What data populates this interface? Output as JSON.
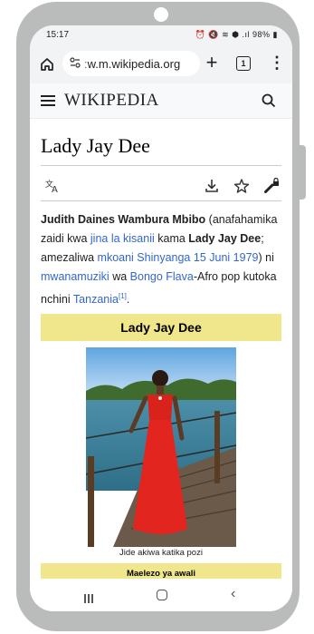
{
  "status_bar": {
    "time": "15:17",
    "indicators": "⏰ 🔇 ≋ ⬢ .ıl",
    "battery": "98%"
  },
  "browser": {
    "url": "ːw.m.wikipedia.org",
    "tab_count": "1"
  },
  "wiki": {
    "wordmark": "WIKIPEDIA",
    "title": "Lady Jay Dee",
    "intro": {
      "name": "Judith Daines Wambura Mbibo",
      "t1": " (anafahamika zaidi kwa ",
      "l1": "jina la kisanii",
      "t2": " kama ",
      "b2": "Lady Jay Dee",
      "t3": "; amezaliwa ",
      "l2": "mkoani Shinyanga",
      "t4": " ",
      "l3": "15 Juni",
      "t5": " ",
      "l4": "1979",
      "t6": ") ni ",
      "l5": "mwanamuziki",
      "t7": " wa ",
      "l6": "Bongo Flava",
      "t8": "-Afro pop kutoka nchini ",
      "l7": "Tanzania",
      "ref": "[1]",
      "t9": "."
    },
    "infobox": {
      "title": "Lady Jay Dee",
      "caption": "Jide akiwa katika pozi",
      "section": "Maelezo ya awali"
    }
  },
  "colors": {
    "accent_link": "#3366cc",
    "infobox_header": "#f0e68c"
  }
}
